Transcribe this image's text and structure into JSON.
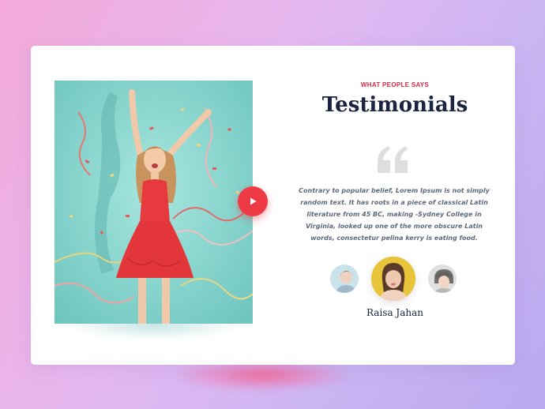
{
  "section": {
    "eyebrow": "WHAT PEOPLE SAYS",
    "title": "Testimonials",
    "quote_icon": "quote-icon",
    "testimonial_text": "Contrary to popular belief, Lorem Ipsum is not simply random text. It has roots in a piece of classical Latin literature from 45 BC, making -Sydney College in Virginia, looked up one of the more obscure Latin words, consectetur pelina kerry is eating food.",
    "author_name": "Raisa Jahan"
  },
  "media": {
    "play_icon": "play-icon"
  },
  "colors": {
    "accent": "#ee3a45",
    "eyebrow": "#d12a45",
    "heading": "#1a2340",
    "body": "#5c6a7c",
    "photo_bg": "#8fd8d2",
    "avatar_active_bg": "#e6c63a"
  }
}
